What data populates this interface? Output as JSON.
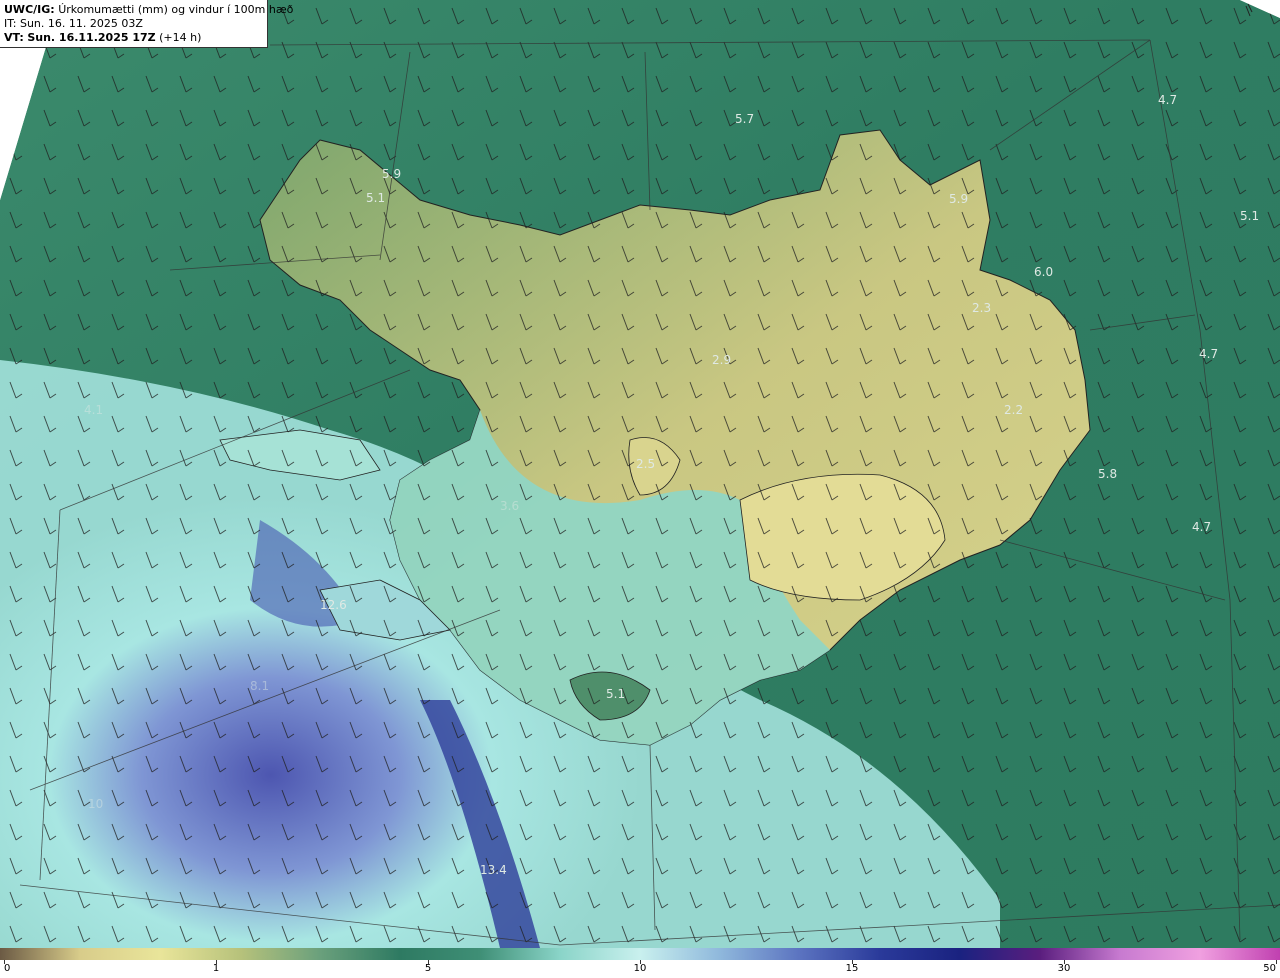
{
  "header": {
    "model": "UWC/IG:",
    "title": "Úrkomumætti (mm) og vindur í 100m hæð",
    "it_label": "IT:",
    "it_time": "Sun. 16. 11. 2025 03Z",
    "vt_label": "VT:",
    "vt_time": "Sun. 16.11.2025 17Z",
    "vt_offset": "(+14 h)"
  },
  "map": {
    "point_values": [
      "4.7",
      "5.7",
      "5.9",
      "5.1",
      "5.9",
      "5.1",
      "6.0",
      "2.3",
      "4.7",
      "2.9",
      "2.2",
      "5.8",
      "4.7",
      "2.5",
      "12.6",
      "5.1",
      "13.4"
    ],
    "faint_values": [
      "4.1",
      "3.6",
      "8.1",
      "10"
    ]
  },
  "colorbar": {
    "ticks": [
      {
        "label": "0",
        "value": 0
      },
      {
        "label": "1",
        "value": 1
      },
      {
        "label": "5",
        "value": 5
      },
      {
        "label": "10",
        "value": 10
      },
      {
        "label": "15",
        "value": 15
      },
      {
        "label": "30",
        "value": 30
      },
      {
        "label": "50",
        "value": 50
      }
    ],
    "colors": [
      "#6b5a44",
      "#d8cc8a",
      "#e9e59a",
      "#b7c27b",
      "#6aa07c",
      "#2e7a62",
      "#3f8f76",
      "#8ad4c8",
      "#c9f0ee",
      "#8fb8dc",
      "#5b73c0",
      "#2a3a9a",
      "#1a2280",
      "#5a1e7e",
      "#c77ad0",
      "#f0a0e0",
      "#c040b0"
    ]
  }
}
